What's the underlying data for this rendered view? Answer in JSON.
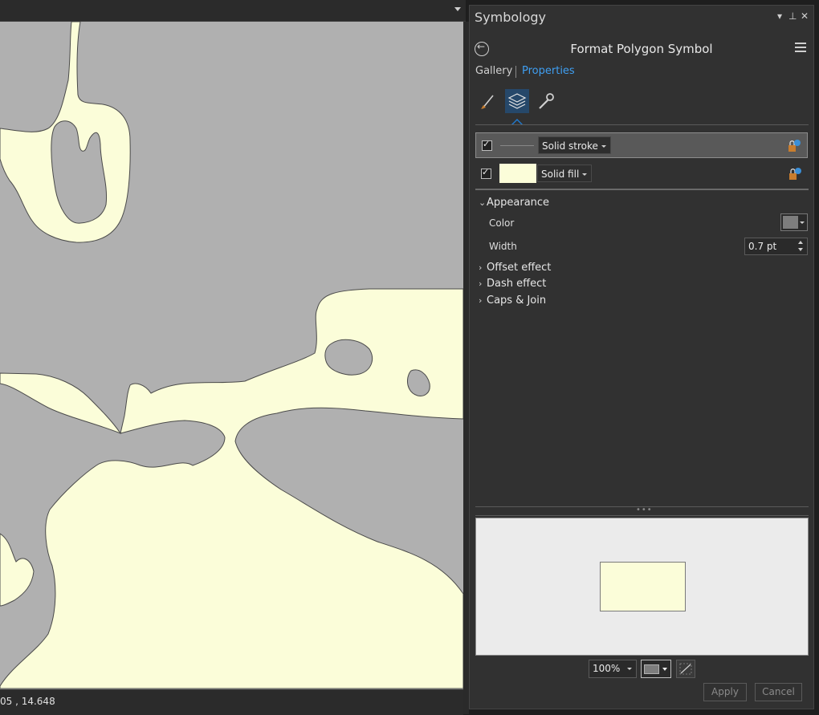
{
  "map": {
    "coordinate_readout": "05 , 14.648",
    "land_color": "#fbfdd9",
    "background_color": "#b0b0b0"
  },
  "pane": {
    "title": "Symbology",
    "controls": {
      "menu": "▾",
      "pin": "⊥",
      "close": "✕"
    },
    "subtitle": "Format Polygon Symbol",
    "tabs": [
      {
        "label": "Gallery",
        "active": false
      },
      {
        "label": "Properties",
        "active": true
      }
    ],
    "modes": [
      {
        "icon": "paintbrush-icon",
        "active": false
      },
      {
        "icon": "layers-icon",
        "active": true
      },
      {
        "icon": "wrench-icon",
        "active": false
      }
    ],
    "layers": [
      {
        "label": "Solid stroke",
        "checked": true,
        "selected": true
      },
      {
        "label": "Solid fill",
        "checked": true,
        "selected": false,
        "swatch": "#fbfdd9"
      }
    ],
    "appearance": {
      "heading": "Appearance",
      "expanded": true,
      "color_label": "Color",
      "color_value": "#7d7d7d",
      "width_label": "Width",
      "width_value": "0.7 pt"
    },
    "sections": [
      {
        "label": "Offset effect",
        "expanded": false
      },
      {
        "label": "Dash effect",
        "expanded": false
      },
      {
        "label": "Caps & Join",
        "expanded": false
      }
    ],
    "preview": {
      "zoom": "100%",
      "background_color": "#7d7d7d",
      "fill_color": "#fbfdd9"
    },
    "buttons": {
      "apply": "Apply",
      "cancel": "Cancel"
    }
  }
}
